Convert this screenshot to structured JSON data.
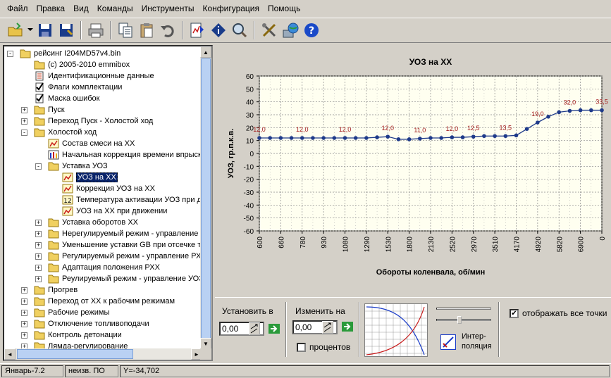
{
  "menu": [
    "Файл",
    "Правка",
    "Вид",
    "Команды",
    "Инструменты",
    "Конфигурация",
    "Помощь"
  ],
  "toolbar": [
    "open-icon",
    "save-icon",
    "save-as-icon",
    "print-icon",
    "copy-icon",
    "paste-icon",
    "undo-icon",
    "compare-icon",
    "info-icon",
    "search-icon",
    "tools-icon",
    "globe-icon",
    "help-icon"
  ],
  "tree": [
    {
      "label": "рейсинг I204MD57v4.bin",
      "level": 0,
      "icon": "folder",
      "exp": "-"
    },
    {
      "label": "(c) 2005-2010 emmibox",
      "level": 1,
      "icon": "folder"
    },
    {
      "label": "Идентификационные данные",
      "level": 1,
      "icon": "doc"
    },
    {
      "label": "Флаги комплектации",
      "level": 1,
      "icon": "check"
    },
    {
      "label": "Маска ошибок",
      "level": 1,
      "icon": "check"
    },
    {
      "label": "Пуск",
      "level": 1,
      "icon": "folder",
      "exp": "+"
    },
    {
      "label": "Переход Пуск - Холостой ход",
      "level": 1,
      "icon": "folder",
      "exp": "+"
    },
    {
      "label": "Холостой ход",
      "level": 1,
      "icon": "folder",
      "exp": "-"
    },
    {
      "label": "Состав смеси на ХХ",
      "level": 2,
      "icon": "chart"
    },
    {
      "label": "Начальная коррекция времени впрыск",
      "level": 2,
      "icon": "bars"
    },
    {
      "label": "Уставка УОЗ",
      "level": 2,
      "icon": "folder",
      "exp": "-"
    },
    {
      "label": "УОЗ на ХХ",
      "level": 3,
      "icon": "chart",
      "selected": true
    },
    {
      "label": "Коррекция УОЗ на ХХ",
      "level": 3,
      "icon": "chart"
    },
    {
      "label": "Температура активации УОЗ при д",
      "level": 3,
      "icon": "num"
    },
    {
      "label": "УОЗ на ХХ при движении",
      "level": 3,
      "icon": "chart"
    },
    {
      "label": "Уставка оборотов ХХ",
      "level": 2,
      "icon": "folder",
      "exp": "+"
    },
    {
      "label": "Нерегулируемый режим - управление",
      "level": 2,
      "icon": "folder",
      "exp": "+"
    },
    {
      "label": "Уменьшение уставки GB при отсечке т",
      "level": 2,
      "icon": "folder",
      "exp": "+"
    },
    {
      "label": "Регулируемый режим - управление РХ",
      "level": 2,
      "icon": "folder",
      "exp": "+"
    },
    {
      "label": "Адаптация положения РХХ",
      "level": 2,
      "icon": "folder",
      "exp": "+"
    },
    {
      "label": "Реулируемый режим - управление УОЗ",
      "level": 2,
      "icon": "folder",
      "exp": "+"
    },
    {
      "label": "Прогрев",
      "level": 1,
      "icon": "folder",
      "exp": "+"
    },
    {
      "label": "Переход от ХХ к рабочим режимам",
      "level": 1,
      "icon": "folder",
      "exp": "+"
    },
    {
      "label": "Рабочие режимы",
      "level": 1,
      "icon": "folder",
      "exp": "+"
    },
    {
      "label": "Отключение топливоподачи",
      "level": 1,
      "icon": "folder",
      "exp": "+"
    },
    {
      "label": "Контроль детонации",
      "level": 1,
      "icon": "folder",
      "exp": "+"
    },
    {
      "label": "Лямда-регулирование",
      "level": 1,
      "icon": "folder",
      "exp": "+"
    }
  ],
  "chart_data": {
    "type": "line",
    "title": "УОЗ на ХХ",
    "xlabel": "Обороты коленвала, об/мин",
    "ylabel": "УОЗ, гр.п.к.в.",
    "ylim": [
      -60,
      60
    ],
    "yticks": [
      60,
      50,
      40,
      30,
      20,
      10,
      0,
      -10,
      -20,
      -30,
      -40,
      -50,
      -60
    ],
    "xticks": [
      "600",
      "660",
      "780",
      "930",
      "1080",
      "1290",
      "1530",
      "1800",
      "2130",
      "2520",
      "2970",
      "3510",
      "4170",
      "4920",
      "5820",
      "6900",
      "0"
    ],
    "x": [
      600,
      620,
      660,
      720,
      780,
      840,
      930,
      1000,
      1080,
      1180,
      1290,
      1400,
      1530,
      1660,
      1800,
      1960,
      2130,
      2320,
      2520,
      2740,
      2970,
      3230,
      3510,
      3830,
      4170,
      4540,
      4920,
      5360,
      5820,
      6330,
      6900,
      7500,
      0
    ],
    "values": [
      12.0,
      12.0,
      12.0,
      12.0,
      12.0,
      12.0,
      12.0,
      12.0,
      12.0,
      12.0,
      12.0,
      12.5,
      13.0,
      11.0,
      11.0,
      11.5,
      12.0,
      12.0,
      12.5,
      12.5,
      13.0,
      13.5,
      13.5,
      13.5,
      14.0,
      19.0,
      24.0,
      28.5,
      32.0,
      33.0,
      33.5,
      33.5,
      33.5
    ],
    "data_labels": [
      {
        "i": 0,
        "text": "12,0"
      },
      {
        "i": 4,
        "text": "12,0"
      },
      {
        "i": 8,
        "text": "12,0"
      },
      {
        "i": 12,
        "text": "12,0"
      },
      {
        "i": 15,
        "text": "11,0"
      },
      {
        "i": 18,
        "text": "12,0"
      },
      {
        "i": 20,
        "text": "12,5"
      },
      {
        "i": 23,
        "text": "13,5"
      },
      {
        "i": 26,
        "text": "19,0"
      },
      {
        "i": 29,
        "text": "32,0"
      },
      {
        "i": 32,
        "text": "33,5"
      }
    ],
    "grid": true,
    "line_color": "#1e3a8a",
    "label_color": "#a01818"
  },
  "panel": {
    "set_label": "Установить в",
    "set_value": "0,00",
    "change_label": "Изменить на",
    "change_value": "0,00",
    "percent_label": "процентов",
    "percent_checked": false,
    "interp_label": "Интер-\nполяция",
    "show_all_label": "отображать все точки",
    "show_all_checked": true
  },
  "status": [
    "Январь-7.2",
    "неизв. ПО",
    "Y=-34,702"
  ]
}
